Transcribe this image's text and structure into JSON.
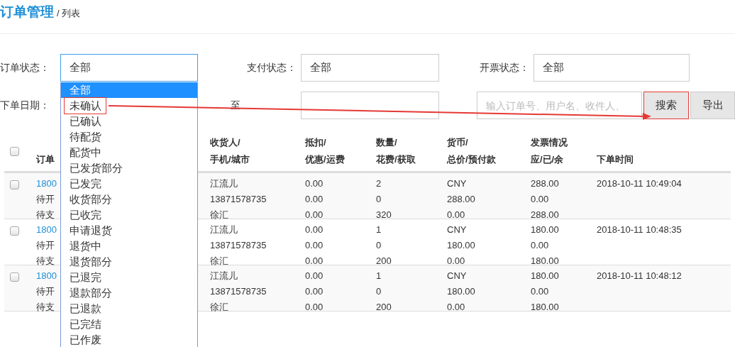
{
  "breadcrumb": {
    "title": "订单管理",
    "current": "/ 列表"
  },
  "filters": [
    {
      "label": "订单状态：",
      "value": "全部",
      "open": true
    },
    {
      "label": "支付状态：",
      "value": "全部",
      "open": false
    },
    {
      "label": "开票状态：",
      "value": "全部",
      "open": false
    }
  ],
  "date_row": {
    "label": "下单日期：",
    "separator": "至"
  },
  "search": {
    "placeholder": "输入订单号、用户名、收件人、"
  },
  "buttons": [
    {
      "label": "搜索",
      "highlighted": true
    },
    {
      "label": "导出",
      "highlighted": false
    }
  ],
  "dropdown_options": [
    {
      "label": "全部",
      "selected": true,
      "highlighted": false
    },
    {
      "label": "未确认",
      "selected": false,
      "highlighted": true
    },
    {
      "label": "已确认",
      "selected": false,
      "highlighted": false
    },
    {
      "label": "待配货",
      "selected": false,
      "highlighted": false
    },
    {
      "label": "配货中",
      "selected": false,
      "highlighted": false
    },
    {
      "label": "已发货部分",
      "selected": false,
      "highlighted": false
    },
    {
      "label": "已发完",
      "selected": false,
      "highlighted": false
    },
    {
      "label": "收货部分",
      "selected": false,
      "highlighted": false
    },
    {
      "label": "已收完",
      "selected": false,
      "highlighted": false
    },
    {
      "label": "申请退货",
      "selected": false,
      "highlighted": false
    },
    {
      "label": "退货中",
      "selected": false,
      "highlighted": false
    },
    {
      "label": "退货部分",
      "selected": false,
      "highlighted": false
    },
    {
      "label": "已退完",
      "selected": false,
      "highlighted": false
    },
    {
      "label": "退款部分",
      "selected": false,
      "highlighted": false
    },
    {
      "label": "已退款",
      "selected": false,
      "highlighted": false
    },
    {
      "label": "已完结",
      "selected": false,
      "highlighted": false
    },
    {
      "label": "已作废",
      "selected": false,
      "highlighted": false
    }
  ],
  "table": {
    "header_checked": false,
    "columns": [
      {
        "line_2": "订单"
      },
      {
        "line_1": "收货人/",
        "line_2": "手机/城市"
      },
      {
        "line_1": "抵扣/",
        "line_2": "优惠/运费"
      },
      {
        "line_1": "数量/",
        "line_2": "花费/获取"
      },
      {
        "line_1": "货币/",
        "line_2": "总价/预付款"
      },
      {
        "line_1": "发票情况",
        "line_2": "应/已/余"
      },
      {
        "line_2": "下单时间"
      }
    ],
    "rows": [
      {
        "checked": false,
        "cells": [
          [
            "1800",
            "待开",
            "待支"
          ],
          [
            "江流儿",
            "13871578735",
            "徐汇"
          ],
          [
            "0.00",
            "0.00",
            "0.00"
          ],
          [
            "2",
            "0",
            "320"
          ],
          [
            "CNY",
            "288.00",
            "0.00"
          ],
          [
            "288.00",
            "0.00",
            "288.00"
          ],
          [
            "2018-10-11 10:49:04"
          ]
        ]
      },
      {
        "checked": false,
        "cells": [
          [
            "1800",
            "待开",
            "待支"
          ],
          [
            "江流儿",
            "13871578735",
            "徐汇"
          ],
          [
            "0.00",
            "0.00",
            "0.00"
          ],
          [
            "1",
            "0",
            "200"
          ],
          [
            "CNY",
            "180.00",
            "0.00"
          ],
          [
            "180.00",
            "0.00",
            "180.00"
          ],
          [
            "2018-10-11 10:48:35"
          ]
        ]
      },
      {
        "checked": false,
        "cells": [
          [
            "1800",
            "待开",
            "待支"
          ],
          [
            "江流儿",
            "13871578735",
            "徐汇"
          ],
          [
            "0.00",
            "0.00",
            "0.00"
          ],
          [
            "1",
            "0",
            "200"
          ],
          [
            "CNY",
            "180.00",
            "0.00"
          ],
          [
            "180.00",
            "0.00",
            "180.00"
          ],
          [
            "2018-10-11 10:48:12"
          ]
        ]
      }
    ]
  }
}
